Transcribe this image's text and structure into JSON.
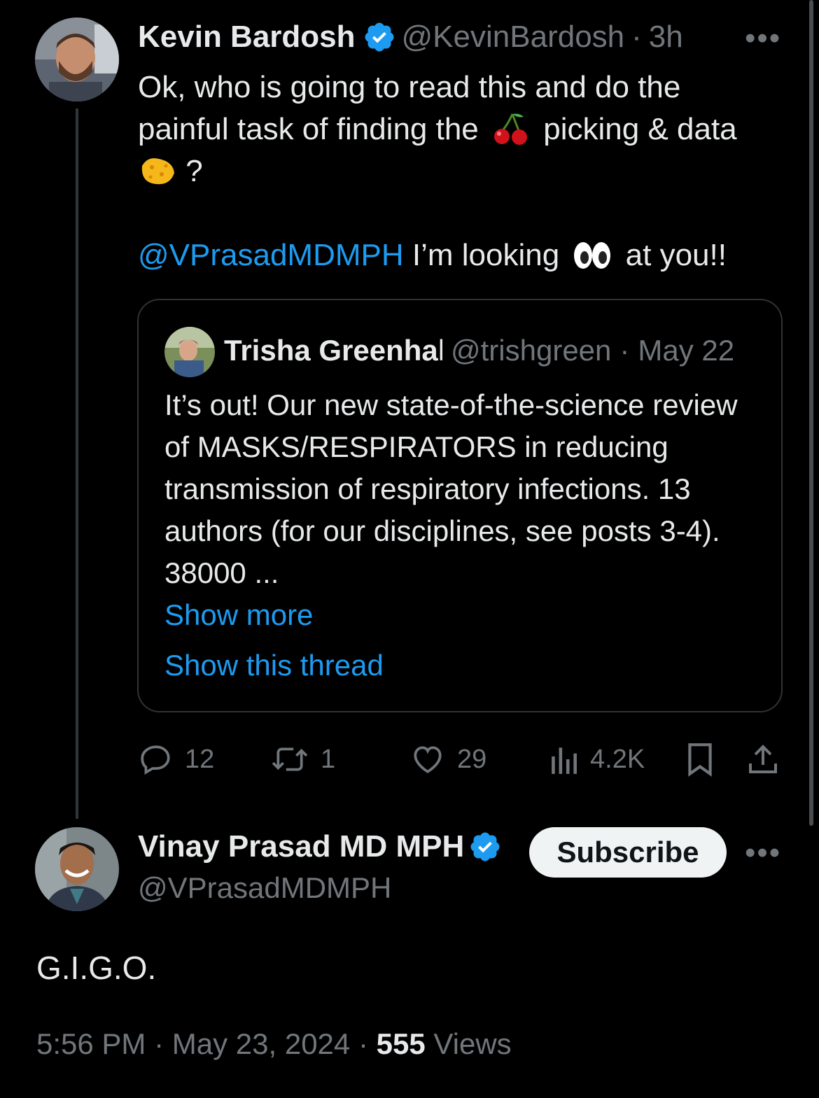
{
  "parent_tweet": {
    "author_name": "Kevin Bardosh",
    "author_handle": "@KevinBardosh",
    "time": "3h",
    "separator": "·",
    "text_line1": "Ok, who is going to read this and do the",
    "text_line2_a": "painful task of finding the",
    "text_line2_b": "picking & data",
    "text_line3": "?",
    "mention": "@VPrasadMDMPH",
    "text_after_mention_a": "I’m looking",
    "text_after_mention_b": "at you!!",
    "emojis": [
      "cherries",
      "sponge",
      "eyes"
    ]
  },
  "quoted_tweet": {
    "author_name": "Trisha Greenhalgh",
    "author_handle": "@trishgreen",
    "separator": "·",
    "date": "May 22",
    "text": "It’s out! Our new state-of-the-science review of MASKS/RESPIRATORS in reducing transmission of respiratory infections. 13 authors (for our disciplines, see posts 3-4). 38000 ...",
    "show_more": "Show more",
    "show_thread": "Show this thread"
  },
  "actions": {
    "replies": "12",
    "reposts": "1",
    "likes": "29",
    "views": "4.2K"
  },
  "reply_tweet": {
    "author_name": "Vinay Prasad MD MPH",
    "author_handle": "@VPrasadMDMPH",
    "subscribe_label": "Subscribe",
    "text": "G.I.G.O.",
    "time": "5:56 PM",
    "date": "May 23, 2024",
    "views_count": "555",
    "views_label": "Views",
    "separator": "·"
  },
  "colors": {
    "background": "#000000",
    "text": "#e7e9ea",
    "muted": "#71767b",
    "link": "#1d9bf0",
    "verified": "#1d9bf0"
  }
}
